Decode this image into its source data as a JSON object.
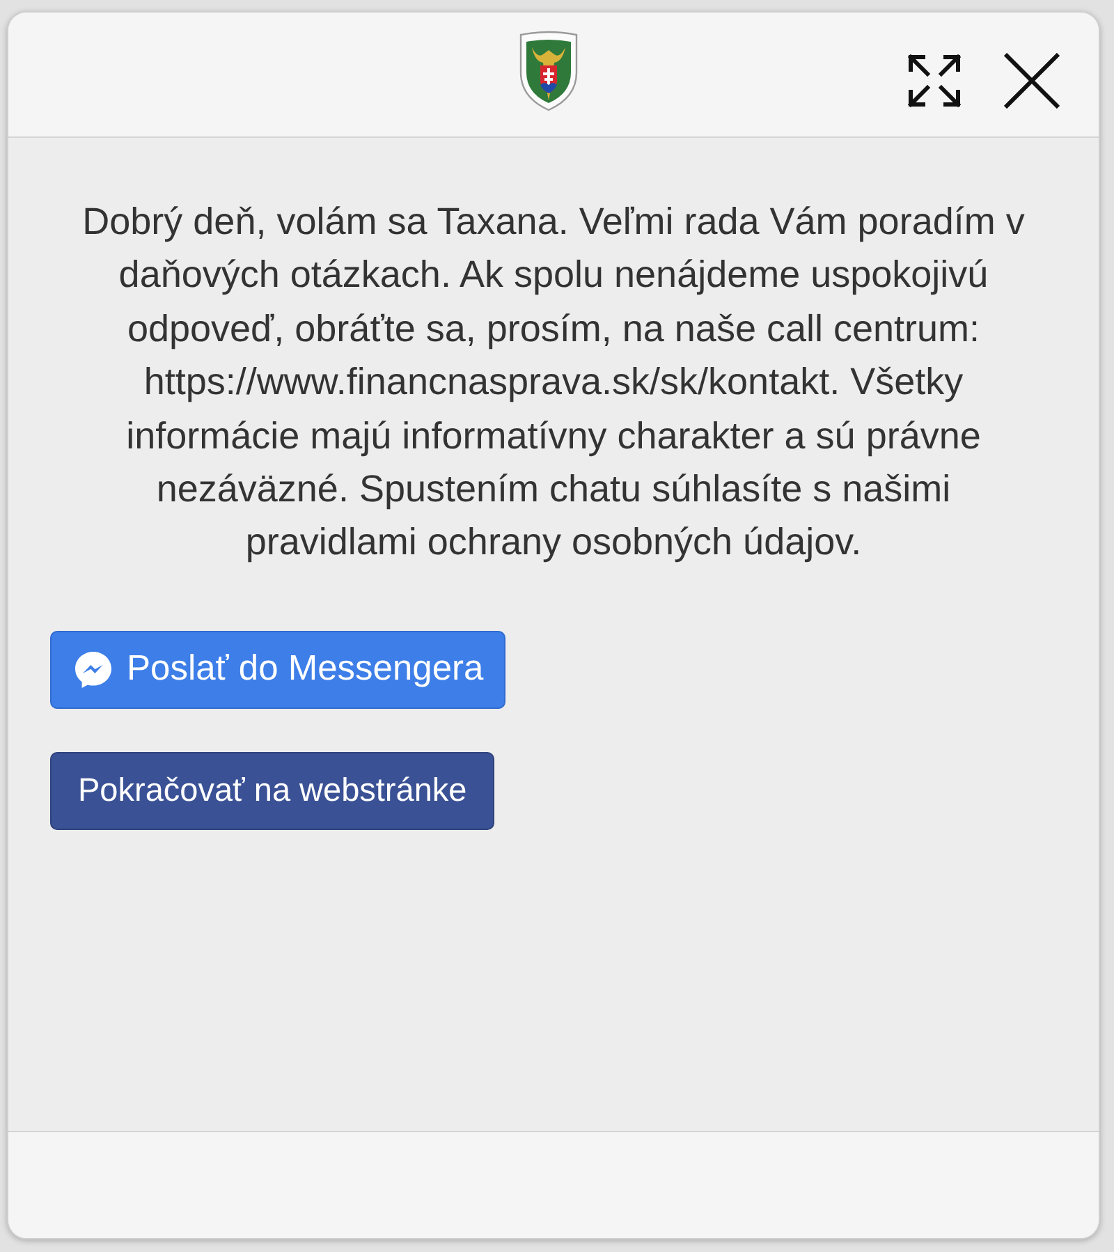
{
  "header": {
    "controls": [
      {
        "kind": "expand"
      },
      {
        "kind": "close"
      }
    ]
  },
  "message": "Dobrý deň, volám sa Taxana. Veľmi rada Vám poradím v daňových otázkach. Ak spolu nenájdeme uspokojivú odpoveď, obráťte sa, prosím, na naše call centrum: https://www.financnasprava.sk/sk/kontakt. Všetky informácie majú informatívny charakter a sú právne nezáväzné. Spustením chatu súhlasíte s našimi pravidlami ochrany osobných údajov.",
  "buttons": [
    {
      "kind": "messenger",
      "label": "Poslať do Messengera"
    },
    {
      "kind": "website",
      "label": "Pokračovať na webstránke"
    }
  ]
}
